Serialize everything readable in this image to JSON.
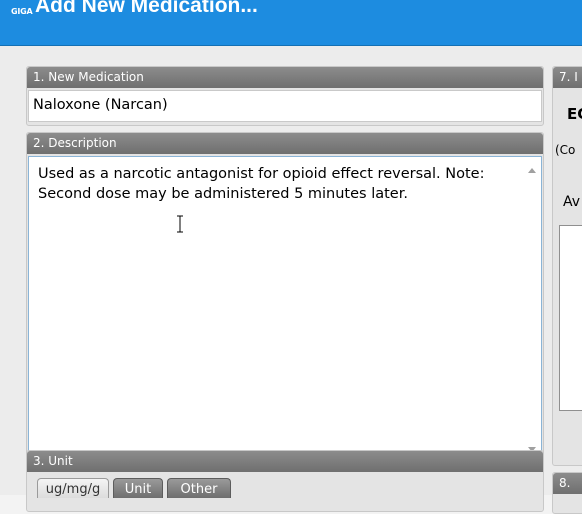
{
  "window": {
    "logo_text": "GIGA",
    "title": "Add New Medication..."
  },
  "sections": {
    "new_medication": {
      "header": "1. New Medication",
      "value": "Naloxone (Narcan)"
    },
    "description": {
      "header": "2. Description",
      "value": "Used as a narcotic antagonist for opioid effect reversal.  Note:  Second dose may be administered 5 minutes later."
    },
    "unit": {
      "header": "3. Unit",
      "tabs": [
        "ug/mg/g",
        "Unit",
        "Other"
      ]
    },
    "section7": {
      "header": "7. I",
      "bold_text": "EC",
      "sub_text": "(Co",
      "label": "Av"
    },
    "section8": {
      "header": "8."
    }
  },
  "colors": {
    "title_bar": "#1d8ce0",
    "header_bar": "#7a7a7a"
  }
}
